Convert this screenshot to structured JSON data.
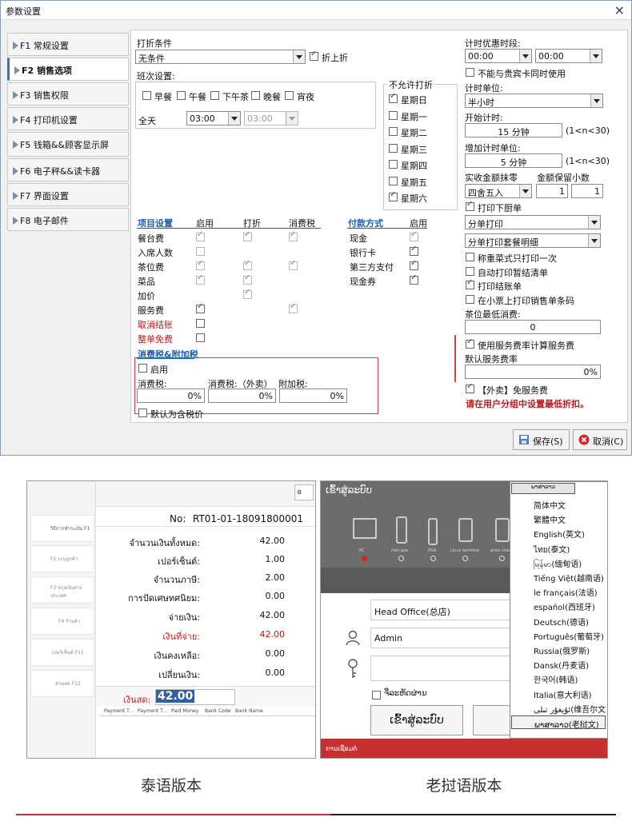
{
  "window": {
    "title": "参数设置",
    "close": "×"
  },
  "nav": [
    {
      "label": "F1 常规设置"
    },
    {
      "label": "F2 销售选项"
    },
    {
      "label": "F3 销售权限"
    },
    {
      "label": "F4 打印机设置"
    },
    {
      "label": "F5 钱箱&&顾客显示屏"
    },
    {
      "label": "F6 电子秤&&读卡器"
    },
    {
      "label": "F7 界面设置"
    },
    {
      "label": "F8 电子邮件"
    }
  ],
  "discount": {
    "label": "打折条件",
    "value": "无条件",
    "checkbox": "折上折"
  },
  "shift": {
    "label": "班次设置:",
    "meals": [
      "早餐",
      "午餐",
      "下午茶",
      "晚餐",
      "宵夜"
    ],
    "allday": "全天",
    "start": "03:00",
    "end": "03:00"
  },
  "no_discount": {
    "title": "不允许打折",
    "days": [
      "星期日",
      "星期一",
      "星期二",
      "星期三",
      "星期四",
      "星期五",
      "星期六"
    ]
  },
  "items": {
    "header": [
      "项目设置",
      "启用",
      "打折",
      "消费税"
    ],
    "rows": [
      "餐台费",
      "入席人数",
      "茶位费",
      "菜品",
      "加价",
      "服务费",
      "取消结账",
      "整单免费"
    ]
  },
  "payment": {
    "header": [
      "付款方式",
      "启用"
    ],
    "rows": [
      "现金",
      "银行卡",
      "第三方支付",
      "现金券"
    ]
  },
  "tax": {
    "title": "消费税&附加税",
    "enable": "启用",
    "tax_label": "消费税:",
    "tax_out_label": "消费税:（外卖）",
    "extra_label": "附加税:",
    "tax_value": "0%",
    "tax_out_value": "0%",
    "extra_value": "0%",
    "default_tax": "默认为含税价"
  },
  "right": {
    "timed_discount": "计时优惠时段:",
    "t1": "00:00",
    "t2": "00:00",
    "vip_exclusive": "不能与贵宾卡同时使用",
    "unit_label": "计时单位:",
    "unit_value": "半小时",
    "start_label": "开始计时:",
    "start_value": "15 分钟",
    "range1": "(1<n<30)",
    "add_label": "增加计时单位:",
    "add_value": "5 分钟",
    "range2": "(1<n<30)",
    "round_label": "实收金额抹零",
    "decimal_label": "金额保留小数",
    "round_value": "四舍五入",
    "decimal_a": "1",
    "decimal_b": "1",
    "print_kitchen": "打印下厨单",
    "print_mode": "分单打印",
    "print_detail": "分单打印套餐明细",
    "weigh_once": "称重菜式只打印一次",
    "auto_print": "自动打印暂结清单",
    "print_bill": "打印结账单",
    "print_barcode": "在小票上打印销售单条码",
    "min_label": "茶位最低消费:",
    "min_value": "0",
    "use_service": "使用服务费率计算服务费",
    "default_rate": "默认服务费率",
    "rate_value": "0%",
    "takeout_free": "【外卖】免服务费",
    "warning": "请在用户分组中设置最低折扣。"
  },
  "buttons": {
    "save": "保存(S)",
    "cancel": "取消(C)"
  },
  "thai": {
    "no_label": "No:",
    "no_value": "RT01-01-18091800001",
    "side": [
      "วิธีการชำระเงิน F1",
      "F2 ระบุลูกค้า",
      "F3 สกุลเงินต่างประเทศ",
      "F4 ร้านค้า",
      "เปอร์เซ็นต์ F11",
      "ส่วนลด F12"
    ],
    "rows": [
      {
        "label": "จำนวนเงินทั้งหมด:",
        "value": "42.00"
      },
      {
        "label": "เปอร์เซ็นต์:",
        "value": "1.00"
      },
      {
        "label": "จำนวนภาษี:",
        "value": "2.00"
      },
      {
        "label": "การปัดเศษทศนิยม:",
        "value": "0.00"
      },
      {
        "label": "จ่ายเงิน:",
        "value": "42.00"
      },
      {
        "label": "เงินที่จ่าย:",
        "value": "42.00"
      },
      {
        "label": "เงินคงเหลือ:",
        "value": "0.00"
      },
      {
        "label": "เปลี่ยนเงิน:",
        "value": "0.00"
      }
    ],
    "cash_label": "เงินสด:",
    "cash_value": "42.00",
    "cols": [
      "Payment T...",
      "Payment T...",
      "Paid Money",
      "Bank Code",
      "Bank Name"
    ]
  },
  "lao": {
    "title": "ເຂົ້າສູ່ລະບົບ",
    "devices": [
      "PC",
      "mini pos",
      "PDA",
      "Linux terminal",
      "price check"
    ],
    "store": "Head Office(总店)",
    "user": "Admin",
    "remember": "ຈື່ລະຫັດຜ່ານ",
    "login": "ເຂົ້າສູ່ລະບົບ",
    "footer": "ການເຊື່ອມຕໍ່",
    "lang_selected": "ພາສາລາວ",
    "languages": [
      "简体中文",
      "繁體中文",
      "English(英文)",
      "ไทย(泰文)",
      "မြန်မာ(缅甸语)",
      "Tiếng Việt(越南语)",
      "le français(法语)",
      "español(西班牙)",
      "Deutsch(德语)",
      "Português(葡萄牙)",
      "Russia(俄罗斯)",
      "Dansk(丹麦语)",
      "한국어(韩语)",
      "Italia(意大利语)",
      "ئۇيغۇر تىلى(维吾尔文)",
      "ພາສາລາວ(老挝文)"
    ]
  },
  "captions": {
    "thai": "泰语版本",
    "lao": "老挝语版本"
  }
}
